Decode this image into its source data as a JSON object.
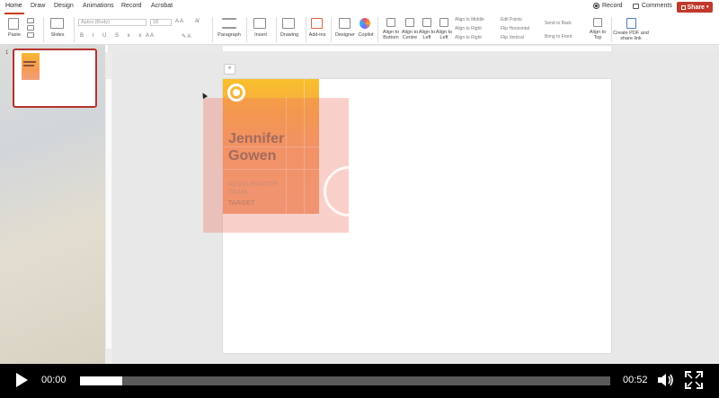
{
  "ribbon_tabs": [
    "Home",
    "Draw",
    "Design",
    "Animations",
    "Record",
    "Acrobat"
  ],
  "active_tab": "Home",
  "header_buttons": {
    "record": "Record",
    "comments": "Comments",
    "share": "Share"
  },
  "ribbon": {
    "paste": "Paste",
    "slides": "Slides",
    "font_name": "Aptos (Body)",
    "font_size": "18",
    "paragraph": "Paragraph",
    "insert": "Insert",
    "drawing": "Drawing",
    "addins": "Add-ins",
    "designer": "Designer",
    "copilot": "Copilot",
    "align_bottom": "Align to Bottom",
    "align_centre": "Align to Centre",
    "align_left": "Align to Left",
    "align_left2": "Align to Left",
    "align_middle": "Align to Middle",
    "align_right": "Align to Right",
    "align_right2": "Align to Right",
    "edit_points": "Edit Points",
    "flip_horizontal": "Flip Horizontal",
    "flip_vertical": "Flip Vertical",
    "send_to_back": "Send to Back",
    "bring_to_front": "Bring to Front",
    "align_top": "Align to Top",
    "create_pdf": "Create PDF and share link"
  },
  "thumbnail": {
    "slide_number": "1"
  },
  "slide": {
    "name_line1": "Jennifer",
    "name_line2": "Gowen",
    "team_line1": "ACCELERATOR",
    "team_line2": "TEAM",
    "target": "TARGET"
  },
  "video": {
    "current_time": "00:00",
    "total_time": "00:52",
    "progress_fraction": 0.08
  },
  "colors": {
    "share_button": "#c0392b",
    "active_tab_underline": "#c43e1c",
    "card_top": "#f9c02b",
    "card_bottom": "#f2a279"
  }
}
